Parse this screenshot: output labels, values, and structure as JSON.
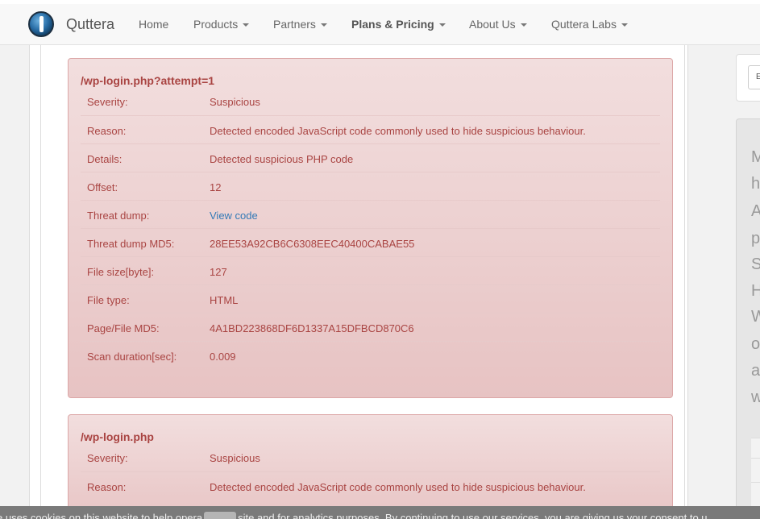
{
  "navbar": {
    "brand": "Quttera",
    "items": [
      {
        "label": "Home",
        "dropdown": false,
        "bold": false
      },
      {
        "label": "Products",
        "dropdown": true,
        "bold": false
      },
      {
        "label": "Partners",
        "dropdown": true,
        "bold": false
      },
      {
        "label": "Plans & Pricing",
        "dropdown": true,
        "bold": true
      },
      {
        "label": "About Us",
        "dropdown": true,
        "bold": false
      },
      {
        "label": "Quttera Labs",
        "dropdown": true,
        "bold": false
      }
    ]
  },
  "panels": [
    {
      "title": "/wp-login.php?attempt=1",
      "rows": [
        {
          "label": "Severity:",
          "value": "Suspicious"
        },
        {
          "label": "Reason:",
          "value": "Detected encoded JavaScript code commonly used to hide suspicious behaviour."
        },
        {
          "label": "Details:",
          "value": "Detected suspicious PHP code"
        },
        {
          "label": "Offset:",
          "value": "12"
        },
        {
          "label": "Threat dump:",
          "value": "View code"
        },
        {
          "label": "Threat dump MD5:",
          "value": "28EE53A92CB6C6308EEC40400CABAE55"
        },
        {
          "label": "File size[byte]:",
          "value": "127"
        },
        {
          "label": "File type:",
          "value": "HTML"
        },
        {
          "label": "Page/File MD5:",
          "value": "4A1BD223868DF6D1337A15DFBCD870C6"
        },
        {
          "label": "Scan duration[sec]:",
          "value": "0.009"
        }
      ]
    },
    {
      "title": "/wp-login.php",
      "rows": [
        {
          "label": "Severity:",
          "value": "Suspicious"
        },
        {
          "label": "Reason:",
          "value": "Detected encoded JavaScript code commonly used to hide suspicious behaviour."
        }
      ]
    }
  ],
  "sidebar": {
    "input_text": "E",
    "letters": [
      "M",
      "h",
      "A",
      "p",
      "S",
      "H",
      "W",
      "o",
      "a",
      "w"
    ]
  },
  "cookie_bar": {
    "text_before": "e uses cookies on this website to help opera",
    "text_after": "site and for analytics purposes. By continuing to use our services, you are giving us your consent to u"
  },
  "colors": {
    "panel_text": "#a94442",
    "link": "#337ab7",
    "panel_bg": "#f2dede"
  }
}
